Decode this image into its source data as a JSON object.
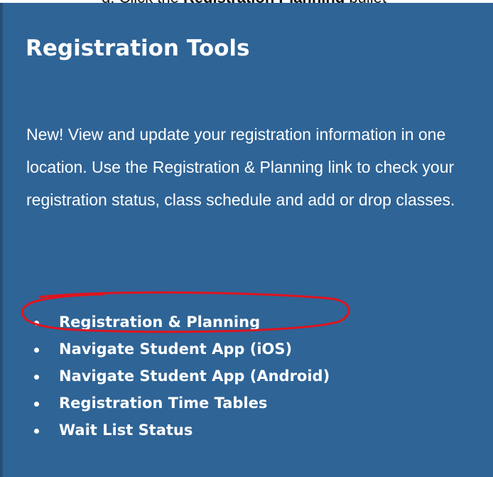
{
  "caption": {
    "prefix": "d.  Click the ",
    "bold": "Registration Planning",
    "suffix": " bullet"
  },
  "panel": {
    "title": "Registration Tools",
    "description": "New! View and update your registration information in one location. Use the Registration & Planning link to check your registration status, class schedule and add or drop classes.",
    "background_color": "#2f6496"
  },
  "links": [
    {
      "label": "Registration & Planning",
      "highlighted": true
    },
    {
      "label": "Navigate Student App (iOS)"
    },
    {
      "label": "Navigate Student App (Android)"
    },
    {
      "label": "Registration Time Tables"
    },
    {
      "label": "Wait List Status"
    }
  ],
  "annotation": {
    "shape": "hand-drawn ellipse",
    "color": "#e0141e",
    "target": "Registration & Planning"
  }
}
